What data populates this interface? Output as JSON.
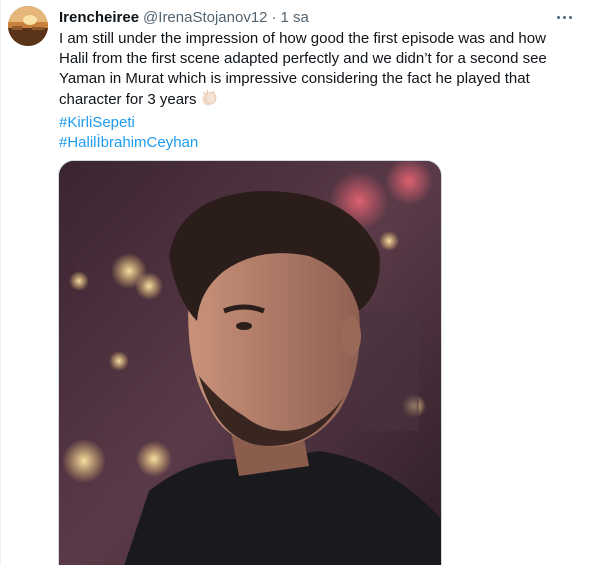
{
  "tweet": {
    "display_name": "Irencheiree",
    "handle": "@IrenaStojanov12",
    "separator": "·",
    "time": "1 sa",
    "text_lines": [
      "I am still under the impression of how good the first episode was and how",
      "Halil from the first scene adapted perfectly and we didn’t for a second see",
      "Yaman in Murat which is impressive considering the fact he played that",
      "character for 3 years"
    ],
    "emoji_icon": "clapping-hands-icon",
    "hashtags": [
      "#KirliSepeti",
      "#HalilİbrahimCeyhan"
    ],
    "more_icon": "more-options-icon",
    "media_alt": "photo",
    "colors": {
      "text": "#0f1419",
      "secondary": "#536471",
      "link": "#1d9bf0",
      "border": "#cfd9de"
    }
  }
}
